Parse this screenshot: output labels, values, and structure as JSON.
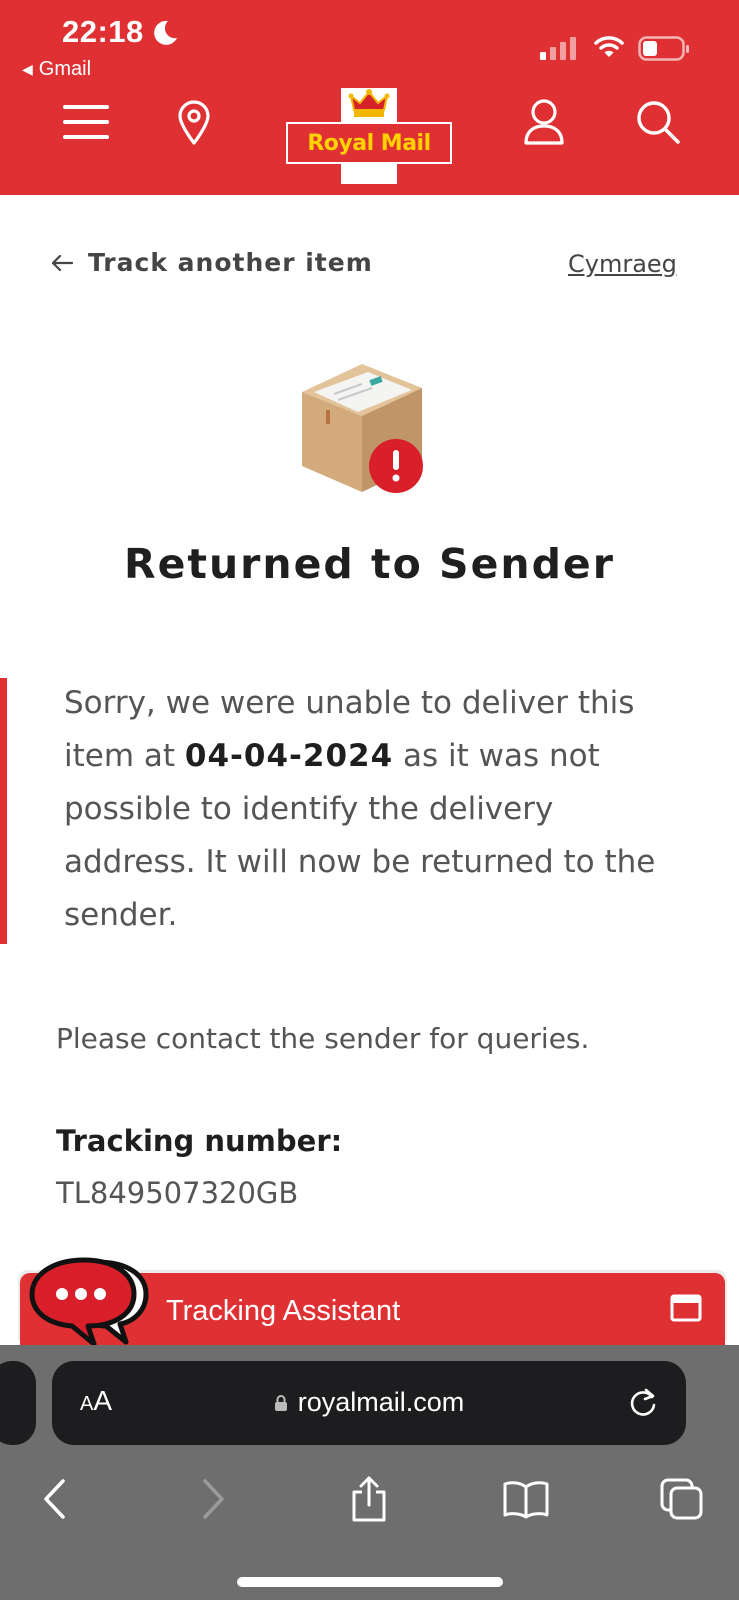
{
  "status_bar": {
    "time": "22:18",
    "back_app": "Gmail"
  },
  "header": {
    "logo_text": "Royal Mail",
    "colors": {
      "brand_red": "#df3134",
      "logo_yellow": "#ffd200"
    }
  },
  "nav": {
    "back_label": "Track another item",
    "language_link": "Cymraeg"
  },
  "tracking": {
    "status_title": "Returned to Sender",
    "message_prefix": "Sorry, we were unable to deliver this item at ",
    "message_date": "04-04-2024",
    "message_suffix": " as it was not possible to identify the delivery address. It will now be returned to the sender.",
    "contact_note": "Please contact the sender for queries.",
    "number_label": "Tracking number:",
    "number_value": "TL849507320GB"
  },
  "assistant": {
    "label": "Tracking Assistant"
  },
  "browser": {
    "text_size_small": "A",
    "text_size_big": "A",
    "url": "royalmail.com"
  }
}
